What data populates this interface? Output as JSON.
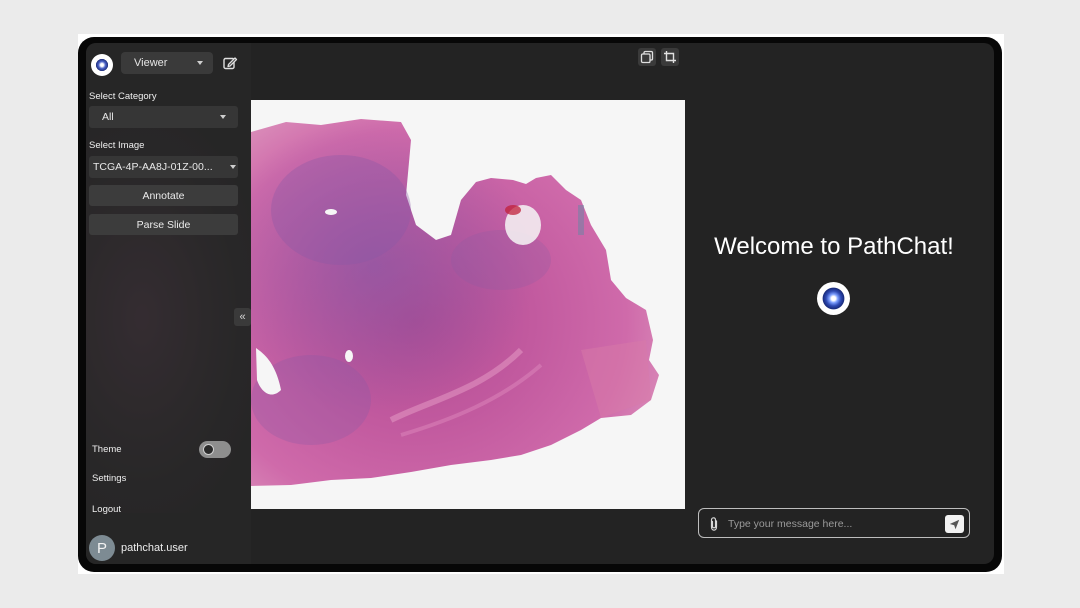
{
  "sidebar": {
    "mode_select": "Viewer",
    "category_label": "Select Category",
    "category_value": "All",
    "image_label": "Select Image",
    "image_value": "TCGA-4P-AA8J-01Z-00...",
    "annotate_label": "Annotate",
    "parse_label": "Parse Slide",
    "collapse_glyph": "«",
    "theme_label": "Theme",
    "settings_label": "Settings",
    "logout_label": "Logout",
    "avatar_initial": "P",
    "username": "pathchat.user"
  },
  "chat": {
    "welcome": "Welcome to PathChat!",
    "placeholder": "Type your message here..."
  },
  "icons": {
    "logo": "pathchat-logo-icon",
    "edit": "edit-icon",
    "copy": "copy-icon",
    "crop": "crop-icon",
    "attach": "paperclip-icon",
    "send": "send-icon"
  },
  "colors": {
    "background": "#232323",
    "sidebar": "#262626",
    "tissue": "#c0559d"
  }
}
